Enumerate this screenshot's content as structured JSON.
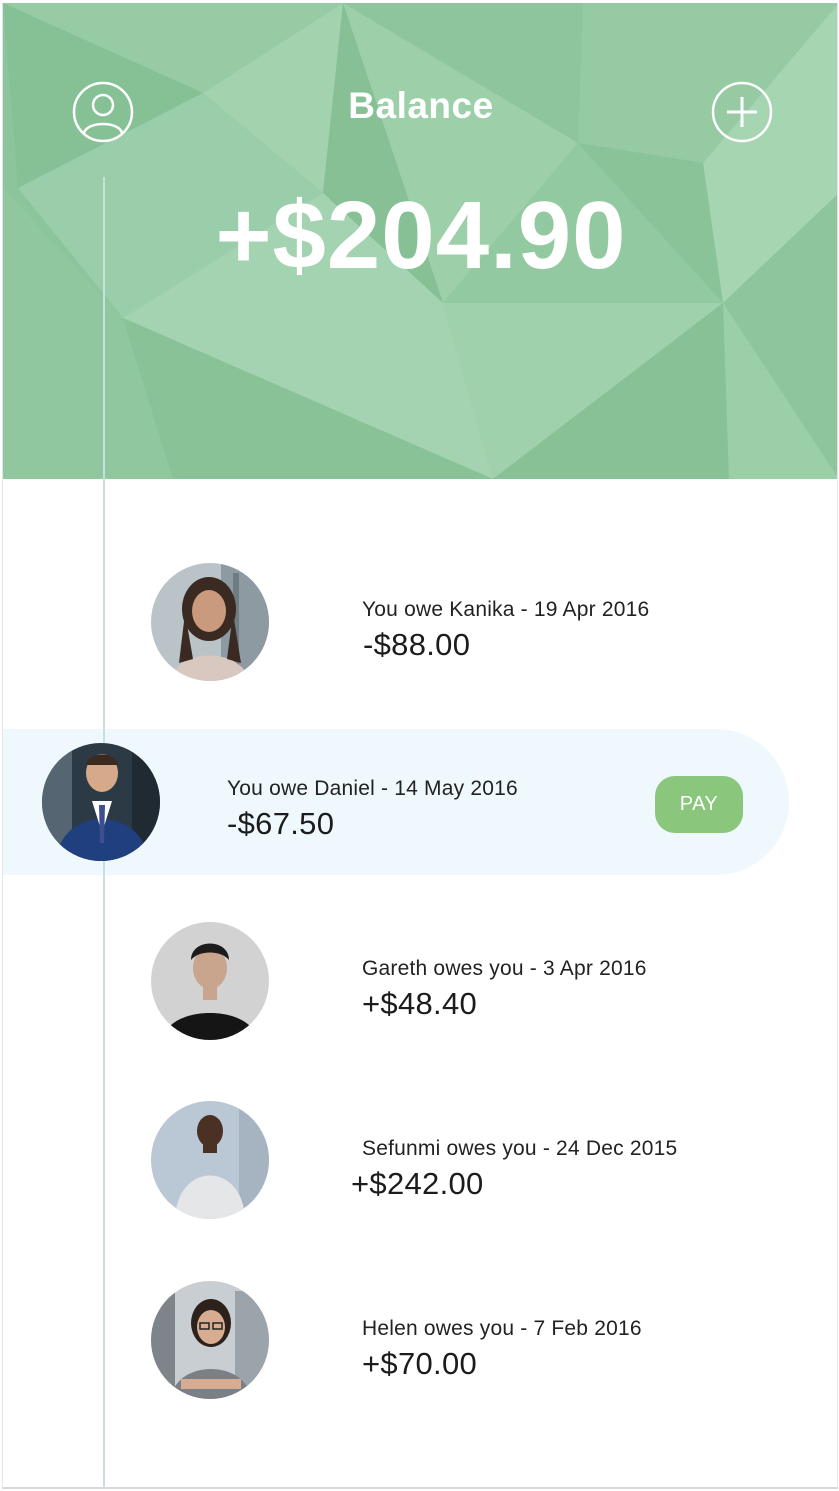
{
  "header": {
    "title": "Balance",
    "balance": "+$204.90",
    "profile_icon": "user-circle-icon",
    "add_icon": "plus-circle-icon",
    "bg_color": "#8cc49c"
  },
  "transactions": [
    {
      "description": "You owe Kanika - 19 Apr 2016",
      "amount": "-$88.00"
    },
    {
      "description": "You owe Daniel - 14 May 2016",
      "amount": "-$67.50",
      "action_label": "PAY",
      "selected": true
    },
    {
      "description": "Gareth owes you - 3 Apr 2016",
      "amount": "+$48.40"
    },
    {
      "description": "Sefunmi owes you - 24 Dec 2015",
      "amount": "+$242.00"
    },
    {
      "description": "Helen owes you - 7 Feb 2016",
      "amount": "+$70.00"
    }
  ],
  "colors": {
    "accent_green": "#8bc67d",
    "highlight_row": "#eff8fc",
    "timeline": "#c7dfdf"
  }
}
